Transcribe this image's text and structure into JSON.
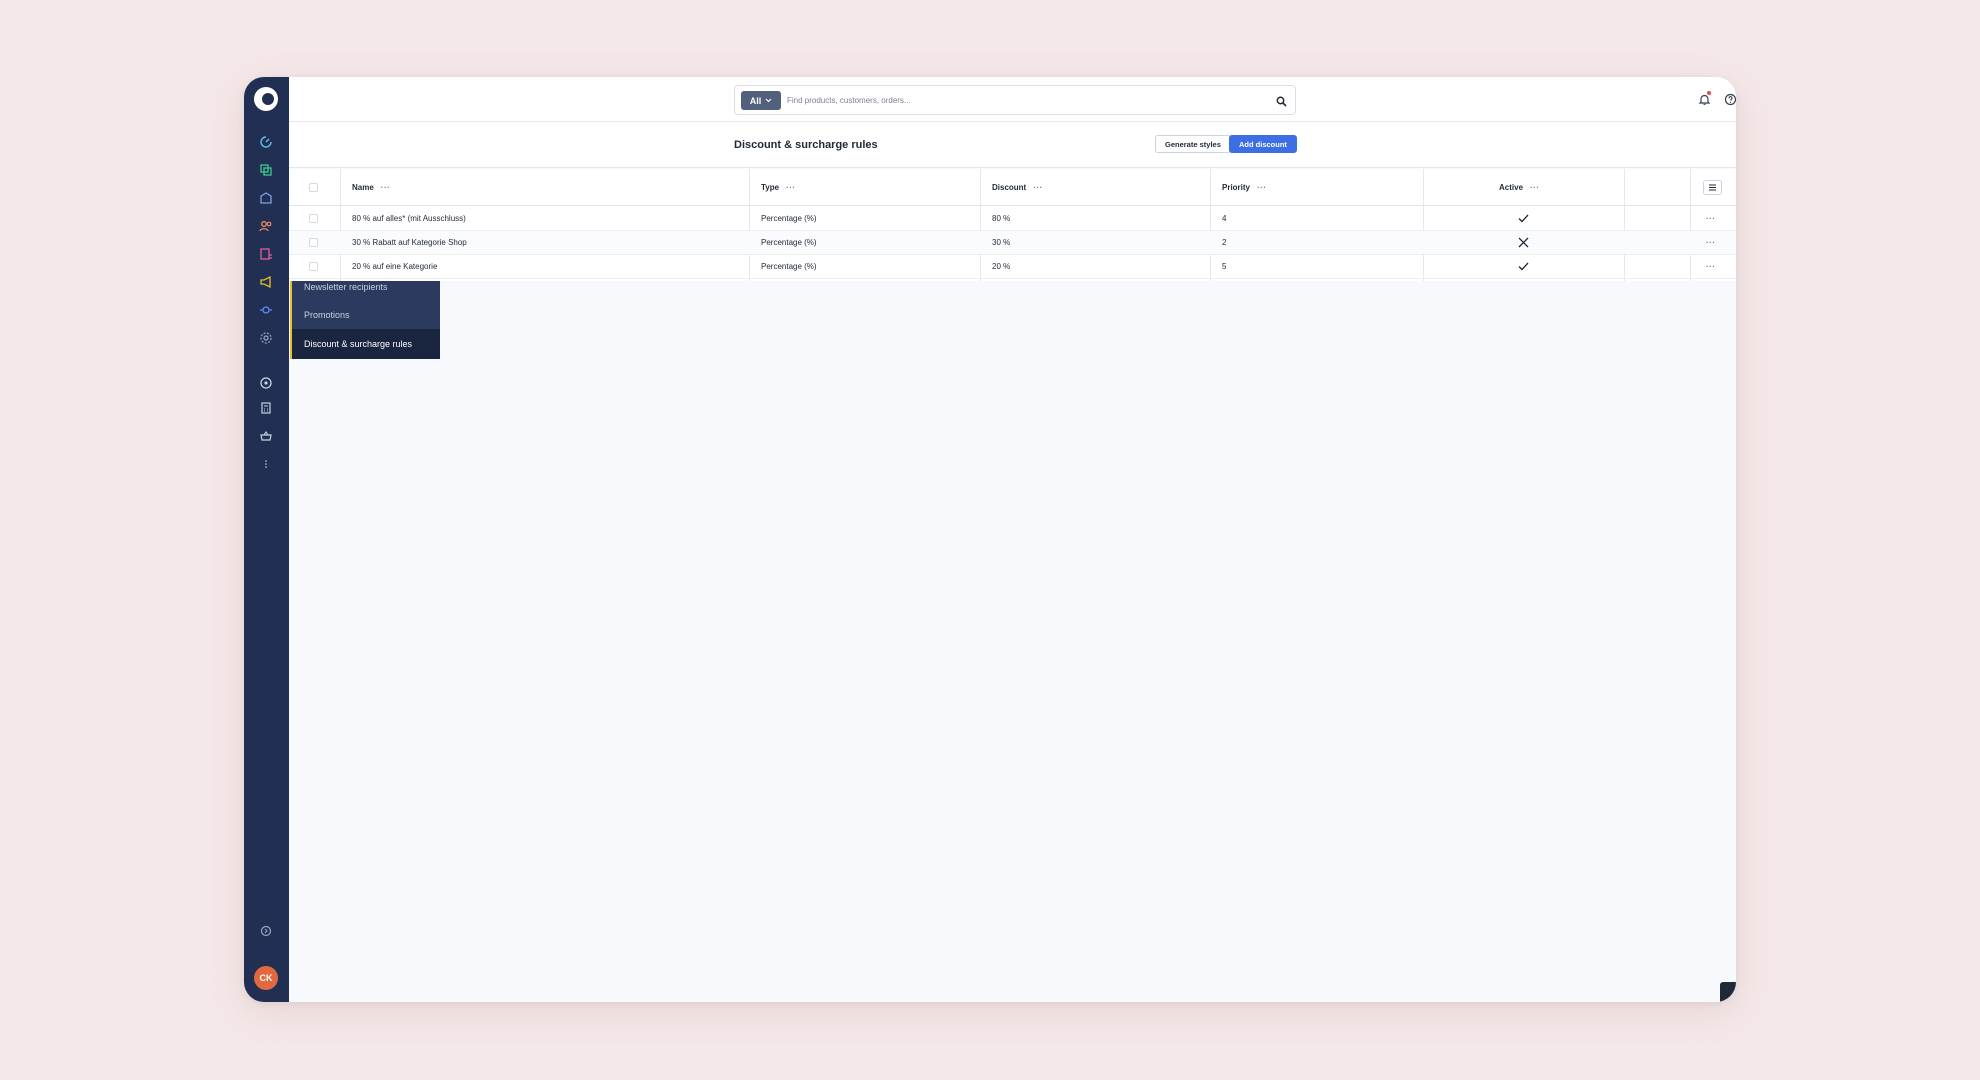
{
  "topbar": {
    "search_scope": "All",
    "search_placeholder": "Find products, customers, orders..."
  },
  "sidebar": {
    "user_initials": "CK",
    "flyout": [
      {
        "label": "Newsletter recipients"
      },
      {
        "label": "Promotions"
      },
      {
        "label": "Discount & surcharge rules"
      }
    ]
  },
  "page": {
    "title": "Discount & surcharge rules",
    "generate_label": "Generate styles",
    "add_label": "Add discount"
  },
  "table": {
    "columns": [
      "Name",
      "Type",
      "Discount",
      "Priority",
      "Active"
    ],
    "rows": [
      {
        "name": "80 % auf alles* (mit Ausschluss)",
        "type": "Percentage (%)",
        "discount": "80 %",
        "priority": "4",
        "active": true
      },
      {
        "name": "30 % Rabatt auf Kategorie Shop",
        "type": "Percentage (%)",
        "discount": "30 %",
        "priority": "2",
        "active": false
      },
      {
        "name": "20 % auf eine Kategorie",
        "type": "Percentage (%)",
        "discount": "20 %",
        "priority": "5",
        "active": true
      }
    ]
  },
  "colors": {
    "sidebar": "#213052",
    "accent": "#3e6ee3",
    "avatar": "#e2683f"
  }
}
